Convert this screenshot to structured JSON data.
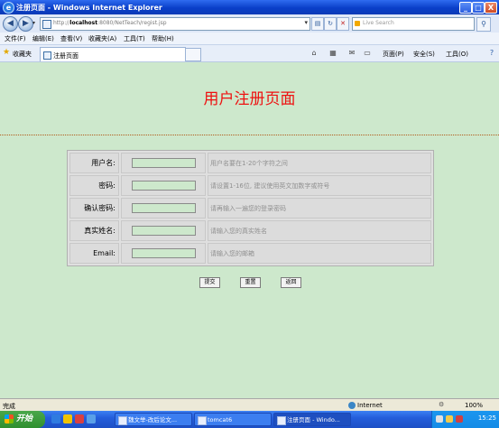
{
  "window": {
    "title": "注册页面 - Windows Internet Explorer",
    "min": "_",
    "max": "□",
    "close": "X"
  },
  "address": {
    "url_prefix": "http://",
    "url_host": "localhost",
    "url_rest": ":8080/NetTeach/regist.jsp",
    "search_placeholder": "Live Search"
  },
  "menu": [
    "文件(F)",
    "编辑(E)",
    "查看(V)",
    "收藏夹(A)",
    "工具(T)",
    "帮助(H)"
  ],
  "favorites": {
    "label": "收藏夹",
    "tab_label": "注册页面",
    "cmd_page": "页面(P)",
    "cmd_safety": "安全(S)",
    "cmd_tools": "工具(O)"
  },
  "page": {
    "heading": "用户注册页面",
    "rows": [
      {
        "label": "用户名:",
        "hint": "用户名要在1-20个字符之间"
      },
      {
        "label": "密码:",
        "hint": "请设置1-16位, 建议使用英文加数字或符号"
      },
      {
        "label": "确认密码:",
        "hint": "请再输入一遍您的登录密码"
      },
      {
        "label": "真实姓名:",
        "hint": "请输入您的真实姓名"
      },
      {
        "label": "Email:",
        "hint": "请输入您的邮箱"
      }
    ],
    "buttons": {
      "submit": "提交",
      "reset": "重置",
      "back": "返回"
    }
  },
  "status": {
    "done": "完成",
    "zone": "Internet",
    "zoom": "100%"
  },
  "taskbar": {
    "start": "开始",
    "tasks": [
      "魏文举-改后论文...",
      "tomcat6",
      "注册页面 - Windo..."
    ],
    "clock": "15:25"
  },
  "colors": {
    "page_bg": "#cde8cc",
    "heading": "#ee1111",
    "divider": "#b05b1b"
  }
}
